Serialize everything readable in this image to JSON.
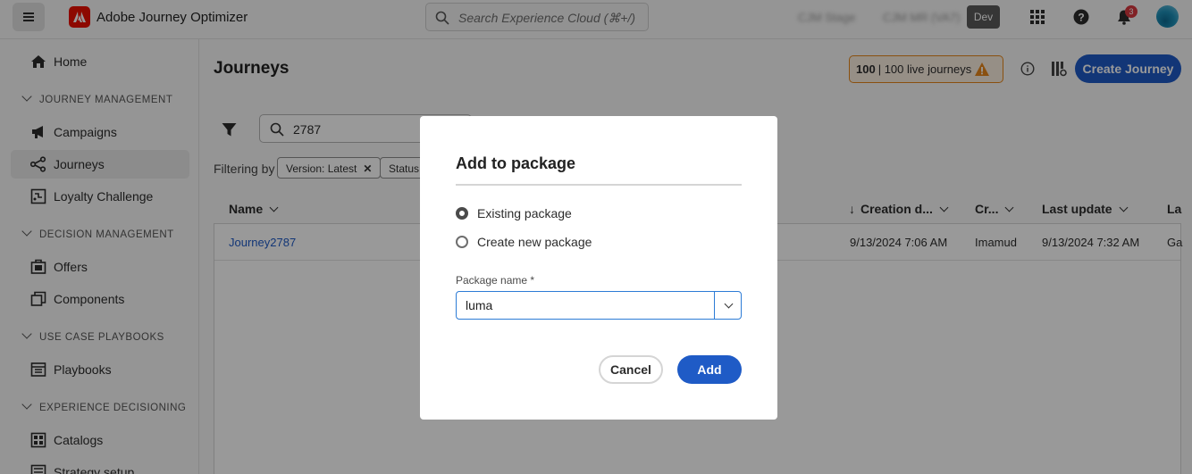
{
  "app": {
    "title": "Adobe Journey Optimizer"
  },
  "search": {
    "placeholder": "Search Experience Cloud (⌘+/)"
  },
  "topbar": {
    "org": "CJM Stage",
    "sandbox": "CJM MR (VA7)",
    "env_badge": "Dev",
    "notification_count": "3"
  },
  "sidebar": {
    "home": "Home",
    "sections": [
      {
        "label": "JOURNEY MANAGEMENT",
        "items": [
          "Campaigns",
          "Journeys",
          "Loyalty Challenge"
        ]
      },
      {
        "label": "DECISION MANAGEMENT",
        "items": [
          "Offers",
          "Components"
        ]
      },
      {
        "label": "USE CASE PLAYBOOKS",
        "items": [
          "Playbooks"
        ]
      },
      {
        "label": "EXPERIENCE DECISIONING",
        "items": [
          "Catalogs",
          "Strategy setup"
        ]
      }
    ]
  },
  "main": {
    "title": "Journeys",
    "live_count": "100",
    "live_label": "| 100 live journeys",
    "create_button": "Create Journey",
    "search_value": "2787",
    "filtering_label": "Filtering by",
    "chips": [
      "Version: Latest",
      "Status:"
    ],
    "columns": [
      "Name",
      "Creation d...",
      "Cr...",
      "Last update",
      "La"
    ],
    "rows": [
      {
        "name": "Journey2787",
        "created": "9/13/2024 7:06 AM",
        "creator": "Imamud",
        "updated": "9/13/2024 7:32 AM",
        "last": "Ga"
      }
    ]
  },
  "dialog": {
    "title": "Add to package",
    "options": [
      "Existing package",
      "Create new package"
    ],
    "selected_option": "Existing package",
    "field_label": "Package name",
    "required_mark": "*",
    "field_value": "luma",
    "cancel": "Cancel",
    "add": "Add"
  }
}
